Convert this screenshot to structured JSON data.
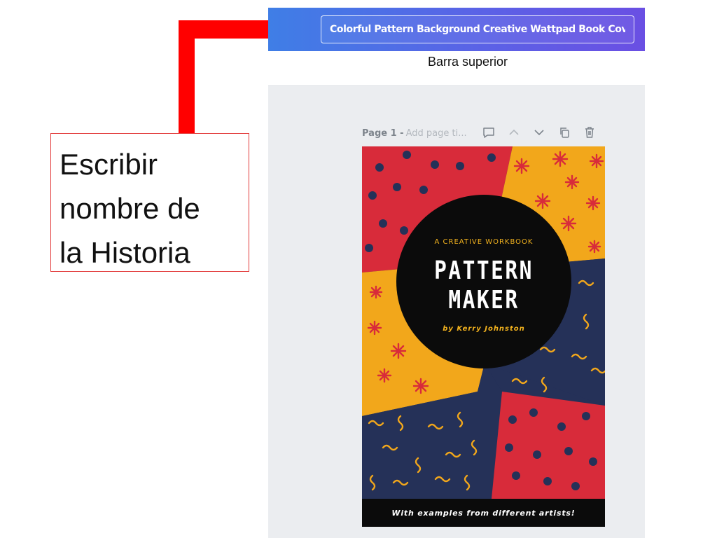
{
  "topbar": {
    "design_title_value": "Colorful Pattern Background Creative Wattpad Book Cover"
  },
  "captions": {
    "topbar_caption": "Barra superior"
  },
  "callout": {
    "text": "Escribir\nnombre de\nla Historia"
  },
  "page_toolbar": {
    "page_label": "Page 1 -",
    "page_title_placeholder": "Add page ti...",
    "icons": [
      "comment-icon",
      "chevron-up-icon",
      "chevron-down-icon",
      "duplicate-icon",
      "trash-icon"
    ]
  },
  "cover": {
    "subtitle": "A CREATIVE WORKBOOK",
    "title_line1": "PATTERN",
    "title_line2": "MAKER",
    "author": "by Kerry Johnston",
    "footer": "With examples from different artists!"
  },
  "colors": {
    "arrow": "#ff0000",
    "cover_red": "#d82b3a",
    "cover_yellow": "#f2a71b",
    "cover_navy": "#253158",
    "cover_black": "#0b0b0b",
    "topbar_start": "#3f7ee6",
    "topbar_end": "#6a4fe3"
  }
}
